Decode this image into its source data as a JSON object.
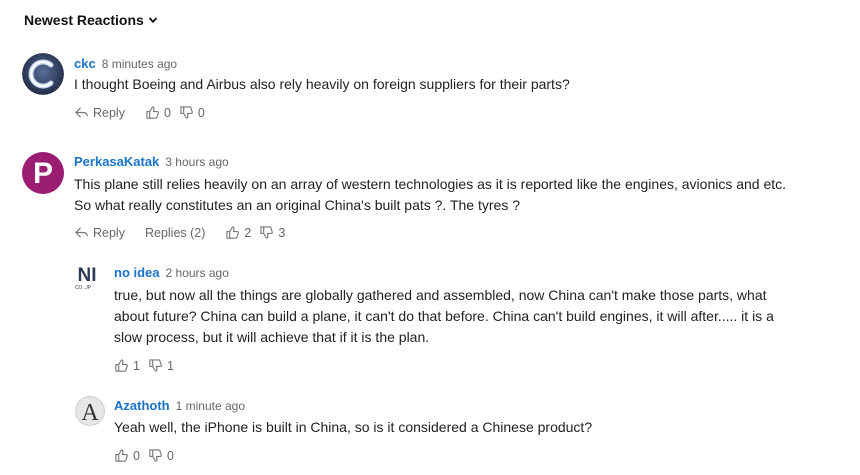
{
  "sort_label": "Newest Reactions",
  "labels": {
    "reply": "Reply"
  },
  "comments": [
    {
      "author": "ckc",
      "time": "8 minutes ago",
      "text": "I thought Boeing and Airbus also rely heavily on foreign suppliers for their parts?",
      "likes": "0",
      "dislikes": "0"
    },
    {
      "author": "PerkasaKatak",
      "time": "3 hours ago",
      "text_line1": "This plane still relies heavily on an array of western technologies as it is reported like the engines, avionics and etc.",
      "text_line2": "So what really constitutes an an original China's built pats ?. The tyres ?",
      "replies_label": "Replies (2)",
      "likes": "2",
      "dislikes": "3"
    },
    {
      "author": "no idea",
      "time": "2 hours ago",
      "text_line1": "true, but now all the things are globally gathered and assembled, now China can't make those parts, what",
      "text_line2": "about future? China can build a plane, it can't do that before. China can't build engines, it will after..... it is a",
      "text_line3": "slow process, but it will achieve that if it is the plan.",
      "likes": "1",
      "dislikes": "1",
      "avatar_letters": "NI",
      "avatar_sub": "CO. JP"
    },
    {
      "author": "Azathoth",
      "time": "1 minute ago",
      "text": "Yeah well, the iPhone is built in China, so is it considered a Chinese product?",
      "likes": "0",
      "dislikes": "0",
      "avatar_letter": "A"
    }
  ],
  "colors": {
    "author": "#1a73c9",
    "avatar_purple": "#9a1d72",
    "avatar_dark": "#2e3a56"
  }
}
